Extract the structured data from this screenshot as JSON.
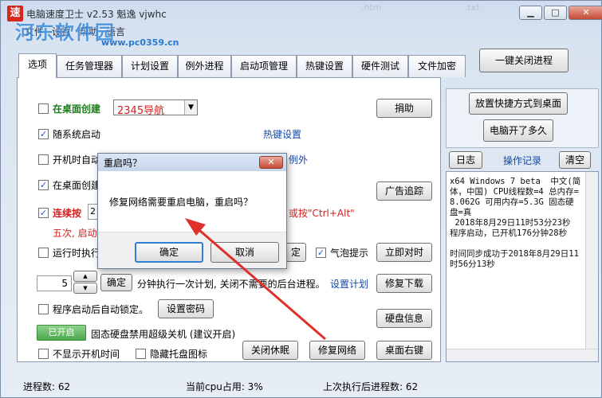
{
  "window": {
    "title": "电脑速度卫士 v2.53  魁逸  vjwhc",
    "watermark": "河东软件园",
    "watermark_url": "www.pc0359.cn",
    "menu": [
      "文件",
      "设置",
      "帮助",
      "语言"
    ],
    "ghost_labels": [
      ".htm",
      ".txt"
    ],
    "controls": {
      "minimize": "▁",
      "maximize": "□",
      "close": "✕"
    }
  },
  "top_button": "一键关闭进程",
  "tabs": [
    "选项",
    "任务管理器",
    "计划设置",
    "例外进程",
    "启动项管理",
    "热键设置",
    "硬件测试",
    "文件加密"
  ],
  "options": {
    "desktop_create": "在桌面创建",
    "desktop_create_select": "2345导航",
    "donate": "捐助",
    "autostart": "随系统启动",
    "hotkey_settings": "热键设置",
    "startup_auto": "开机时自动",
    "exception_tail": "例外",
    "desktop_create2": "在桌面创建",
    "ad_trace": "广告追踪",
    "consecutive": "连续按",
    "consecutive_value": "2",
    "hotkey_hint": "或按\"Ctrl+Alt\"",
    "five_times": "五次, 启动",
    "run_exec": "运行时执行",
    "confirm_short": "定",
    "bubble_tip": "气泡提示",
    "sync_time": "立即对时",
    "spin_value": "5",
    "spin_up": "▲",
    "spin_down": "▼",
    "confirm_btn": "确定",
    "plan_text": "分钟执行一次计划, 关闭不需要的后台进程。",
    "set_plan": "设置计划",
    "repair_download": "修复下载",
    "lock_after_start": "程序启动后自动锁定。",
    "set_password": "设置密码",
    "disk_info": "硬盘信息",
    "toggle_on": "已开启",
    "ssd_text": "固态硬盘禁用超级关机 (建议开启)",
    "hide_boot_time": "不显示开机时间",
    "hide_tray": "隐藏托盘图标",
    "close_hibernate": "关闭休眠",
    "repair_network": "修复网络",
    "desktop_right": "桌面右键"
  },
  "right": {
    "place_shortcut": "放置快捷方式到桌面",
    "uptime": "电脑开了多久",
    "log_btn": "日志",
    "log_title": "操作记录",
    "clear_btn": "清空",
    "log_text": "x64 Windows 7 beta  中文(简体，中国) CPU线程数=4 总内存=8.062G 可用内存=5.3G 固态硬盘=真\n 2018年8月29日11时53分23秒 程序启动，已开机176分钟28秒\n\n时间同步成功于2018年8月29日11时56分13秒"
  },
  "status": {
    "procs": "进程数: 62",
    "cpu": "当前cpu占用: 3%",
    "last": "上次执行后进程数: 62"
  },
  "dialog": {
    "title": "重启吗？",
    "close": "✕",
    "message": "修复网络需要重启电脑，重启吗？",
    "ok": "确定",
    "cancel": "取消"
  },
  "colors": {
    "arrow": "#e0302b",
    "accent": "#1546a8",
    "warn": "#d12020"
  }
}
